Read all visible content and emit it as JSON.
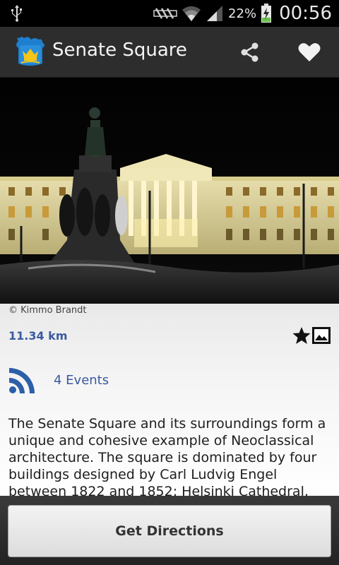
{
  "status_bar": {
    "battery_percent": "22%",
    "time": "00:56",
    "icons": [
      "usb-icon",
      "nfc-icon",
      "wifi-icon",
      "signal-icon",
      "battery-charging-icon"
    ]
  },
  "action_bar": {
    "title": "Senate Square",
    "actions": [
      "share-icon",
      "heart-icon"
    ]
  },
  "photo": {
    "credit": "© Kimmo Brandt"
  },
  "details": {
    "distance": "11.34 km",
    "actions": [
      "star-icon",
      "gallery-icon"
    ]
  },
  "events": {
    "label": "4 Events",
    "icon": "rss-icon"
  },
  "description": "The Senate Square and its surroundings form a unique and cohesive example of Neoclassical architecture. The square is dominated by four buildings designed by Carl Ludvig Engel between 1822 and 1852: Helsinki Cathedral, the",
  "bottom": {
    "button_label": "Get Directions"
  },
  "colors": {
    "status_bar": "#000000",
    "action_bar": "#2d2d2d",
    "link_blue": "#3a5aa0",
    "text_dark": "#1e1e1e",
    "building_facade": "#e2d9a0"
  }
}
